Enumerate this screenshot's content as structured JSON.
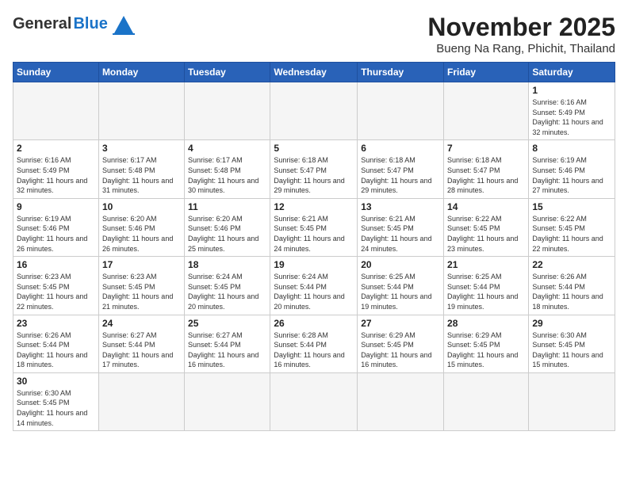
{
  "logo": {
    "text_general": "General",
    "text_blue": "Blue"
  },
  "title": "November 2025",
  "subtitle": "Bueng Na Rang, Phichit, Thailand",
  "weekdays": [
    "Sunday",
    "Monday",
    "Tuesday",
    "Wednesday",
    "Thursday",
    "Friday",
    "Saturday"
  ],
  "days": {
    "1": {
      "sunrise": "6:16 AM",
      "sunset": "5:49 PM",
      "daylight": "11 hours and 32 minutes."
    },
    "2": {
      "sunrise": "6:16 AM",
      "sunset": "5:49 PM",
      "daylight": "11 hours and 32 minutes."
    },
    "3": {
      "sunrise": "6:17 AM",
      "sunset": "5:48 PM",
      "daylight": "11 hours and 31 minutes."
    },
    "4": {
      "sunrise": "6:17 AM",
      "sunset": "5:48 PM",
      "daylight": "11 hours and 30 minutes."
    },
    "5": {
      "sunrise": "6:18 AM",
      "sunset": "5:47 PM",
      "daylight": "11 hours and 29 minutes."
    },
    "6": {
      "sunrise": "6:18 AM",
      "sunset": "5:47 PM",
      "daylight": "11 hours and 29 minutes."
    },
    "7": {
      "sunrise": "6:18 AM",
      "sunset": "5:47 PM",
      "daylight": "11 hours and 28 minutes."
    },
    "8": {
      "sunrise": "6:19 AM",
      "sunset": "5:46 PM",
      "daylight": "11 hours and 27 minutes."
    },
    "9": {
      "sunrise": "6:19 AM",
      "sunset": "5:46 PM",
      "daylight": "11 hours and 26 minutes."
    },
    "10": {
      "sunrise": "6:20 AM",
      "sunset": "5:46 PM",
      "daylight": "11 hours and 26 minutes."
    },
    "11": {
      "sunrise": "6:20 AM",
      "sunset": "5:46 PM",
      "daylight": "11 hours and 25 minutes."
    },
    "12": {
      "sunrise": "6:21 AM",
      "sunset": "5:45 PM",
      "daylight": "11 hours and 24 minutes."
    },
    "13": {
      "sunrise": "6:21 AM",
      "sunset": "5:45 PM",
      "daylight": "11 hours and 24 minutes."
    },
    "14": {
      "sunrise": "6:22 AM",
      "sunset": "5:45 PM",
      "daylight": "11 hours and 23 minutes."
    },
    "15": {
      "sunrise": "6:22 AM",
      "sunset": "5:45 PM",
      "daylight": "11 hours and 22 minutes."
    },
    "16": {
      "sunrise": "6:23 AM",
      "sunset": "5:45 PM",
      "daylight": "11 hours and 22 minutes."
    },
    "17": {
      "sunrise": "6:23 AM",
      "sunset": "5:45 PM",
      "daylight": "11 hours and 21 minutes."
    },
    "18": {
      "sunrise": "6:24 AM",
      "sunset": "5:45 PM",
      "daylight": "11 hours and 20 minutes."
    },
    "19": {
      "sunrise": "6:24 AM",
      "sunset": "5:44 PM",
      "daylight": "11 hours and 20 minutes."
    },
    "20": {
      "sunrise": "6:25 AM",
      "sunset": "5:44 PM",
      "daylight": "11 hours and 19 minutes."
    },
    "21": {
      "sunrise": "6:25 AM",
      "sunset": "5:44 PM",
      "daylight": "11 hours and 19 minutes."
    },
    "22": {
      "sunrise": "6:26 AM",
      "sunset": "5:44 PM",
      "daylight": "11 hours and 18 minutes."
    },
    "23": {
      "sunrise": "6:26 AM",
      "sunset": "5:44 PM",
      "daylight": "11 hours and 18 minutes."
    },
    "24": {
      "sunrise": "6:27 AM",
      "sunset": "5:44 PM",
      "daylight": "11 hours and 17 minutes."
    },
    "25": {
      "sunrise": "6:27 AM",
      "sunset": "5:44 PM",
      "daylight": "11 hours and 16 minutes."
    },
    "26": {
      "sunrise": "6:28 AM",
      "sunset": "5:44 PM",
      "daylight": "11 hours and 16 minutes."
    },
    "27": {
      "sunrise": "6:29 AM",
      "sunset": "5:45 PM",
      "daylight": "11 hours and 16 minutes."
    },
    "28": {
      "sunrise": "6:29 AM",
      "sunset": "5:45 PM",
      "daylight": "11 hours and 15 minutes."
    },
    "29": {
      "sunrise": "6:30 AM",
      "sunset": "5:45 PM",
      "daylight": "11 hours and 15 minutes."
    },
    "30": {
      "sunrise": "6:30 AM",
      "sunset": "5:45 PM",
      "daylight": "11 hours and 14 minutes."
    }
  }
}
